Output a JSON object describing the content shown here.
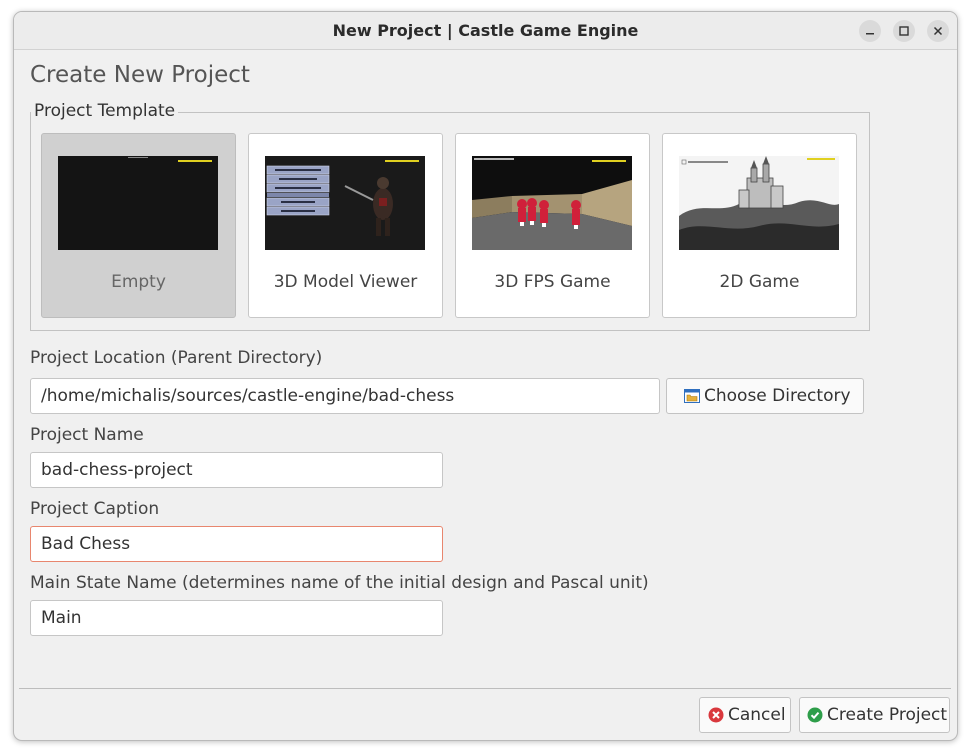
{
  "window": {
    "title": "New Project | Castle Game Engine",
    "controls": [
      "minimize-icon",
      "maximize-icon",
      "close-icon"
    ]
  },
  "heading": "Create New Project",
  "template_group": {
    "label": "Project Template",
    "templates": [
      {
        "label": "Empty",
        "selected": true
      },
      {
        "label": "3D Model Viewer",
        "selected": false
      },
      {
        "label": "3D FPS Game",
        "selected": false
      },
      {
        "label": "2D Game",
        "selected": false
      }
    ]
  },
  "location": {
    "label": "Project Location (Parent Directory)",
    "value": "/home/michalis/sources/castle-engine/bad-chess",
    "choose_button": "Choose Directory",
    "choose_icon": "folder-icon"
  },
  "name": {
    "label": "Project Name",
    "value": "bad-chess-project"
  },
  "caption": {
    "label": "Project Caption",
    "value": "Bad Chess"
  },
  "main_state": {
    "label": "Main State Name (determines name of the initial design and Pascal unit)",
    "value": "Main"
  },
  "buttons": {
    "cancel": "Cancel",
    "cancel_icon": "cancel-icon",
    "create": "Create Project",
    "create_icon": "check-icon"
  },
  "colors": {
    "error_border": "#e8866e",
    "cancel_red": "#d9383d",
    "create_green": "#2e9e4a",
    "selected_tile": "#d0d0d0"
  }
}
